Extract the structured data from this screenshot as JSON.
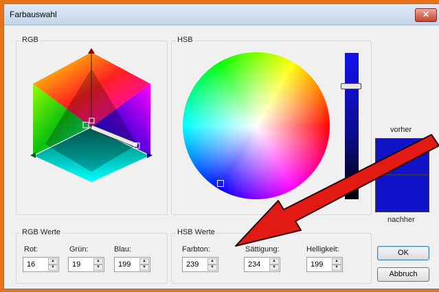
{
  "window": {
    "title": "Farbauswahl",
    "close_glyph": "✕"
  },
  "rgb_group": {
    "label": "RGB"
  },
  "hsb_group": {
    "label": "HSB"
  },
  "preview": {
    "before_label": "vorher",
    "after_label": "nachher",
    "color": "#1013c7"
  },
  "rgb_values": {
    "group_label": "RGB Werte",
    "red_label": "Rot:",
    "red": "16",
    "green_label": "Grün:",
    "green": "19",
    "blue_label": "Blau:",
    "blue": "199"
  },
  "hsb_values": {
    "group_label": "HSB Werte",
    "hue_label": "Farbton:",
    "hue": "239",
    "saturation_label": "Sättigung:",
    "saturation": "234",
    "brightness_label": "Helligkeit:",
    "brightness": "199"
  },
  "buttons": {
    "ok": "OK",
    "cancel": "Abbruch"
  },
  "colors": {
    "annotation_arrow": "#e11b14",
    "frame_orange": "#e8721a"
  }
}
